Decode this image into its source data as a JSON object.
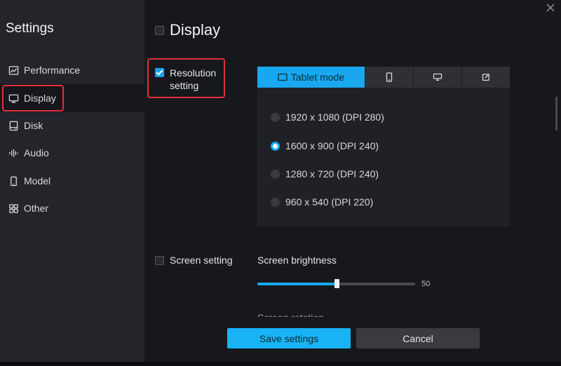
{
  "sidebar": {
    "title": "Settings",
    "items": [
      {
        "label": "Performance",
        "icon": "performance-chart-icon"
      },
      {
        "label": "Display",
        "icon": "monitor-icon"
      },
      {
        "label": "Disk",
        "icon": "disk-icon"
      },
      {
        "label": "Audio",
        "icon": "audio-wave-icon"
      },
      {
        "label": "Model",
        "icon": "phone-icon"
      },
      {
        "label": "Other",
        "icon": "grid-icon"
      }
    ],
    "active": "Display"
  },
  "main": {
    "section_title": "Display",
    "resolution": {
      "label_line1": "Resolution",
      "label_line2": "setting",
      "checked": true,
      "tabs": [
        {
          "label": "Tablet mode",
          "icon": "tablet-icon",
          "active": true
        },
        {
          "label": "",
          "icon": "phone-portrait-icon",
          "active": false
        },
        {
          "label": "",
          "icon": "desktop-icon",
          "active": false
        },
        {
          "label": "",
          "icon": "custom-edit-icon",
          "active": false
        }
      ],
      "options": [
        {
          "label": "1920 x 1080 (DPI 280)",
          "selected": false
        },
        {
          "label": "1600 x 900 (DPI 240)",
          "selected": true
        },
        {
          "label": "1280 x 720 (DPI 240)",
          "selected": false
        },
        {
          "label": "960 x 540 (DPI 220)",
          "selected": false
        }
      ]
    },
    "screen": {
      "label": "Screen setting",
      "checked": false,
      "brightness_label": "Screen brightness",
      "brightness_value": "50",
      "brightness_fraction": 0.5,
      "clipped_label": "Screen rotation"
    },
    "buttons": {
      "save": "Save settings",
      "cancel": "Cancel"
    }
  },
  "colors": {
    "accent": "#19a8f0",
    "highlight_box": "#e0303b",
    "sidebar_bg": "#24252b",
    "main_bg": "#17181c"
  }
}
